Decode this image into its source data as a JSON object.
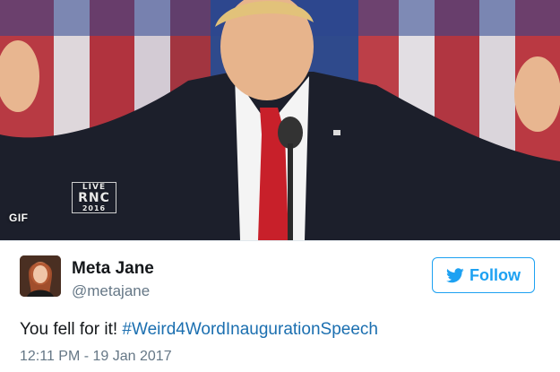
{
  "media": {
    "type_badge": "GIF",
    "broadcast_badge": {
      "line1": "LIVE",
      "line2": "RNC",
      "line3": "2016"
    }
  },
  "tweet": {
    "author": {
      "name": "Meta Jane",
      "handle": "@metajane",
      "avatar_icon": "profile-photo"
    },
    "follow_button": {
      "label": "Follow",
      "icon": "twitter-bird-icon"
    },
    "text": "You fell for it! ",
    "hashtag": "#Weird4WordInaugurationSpeech",
    "timestamp": "12:11 PM - 19 Jan 2017"
  },
  "colors": {
    "brand_blue": "#1da1f2",
    "hashtag_blue": "#1b6fb0",
    "text_primary": "#14171a",
    "text_secondary": "#657786"
  }
}
